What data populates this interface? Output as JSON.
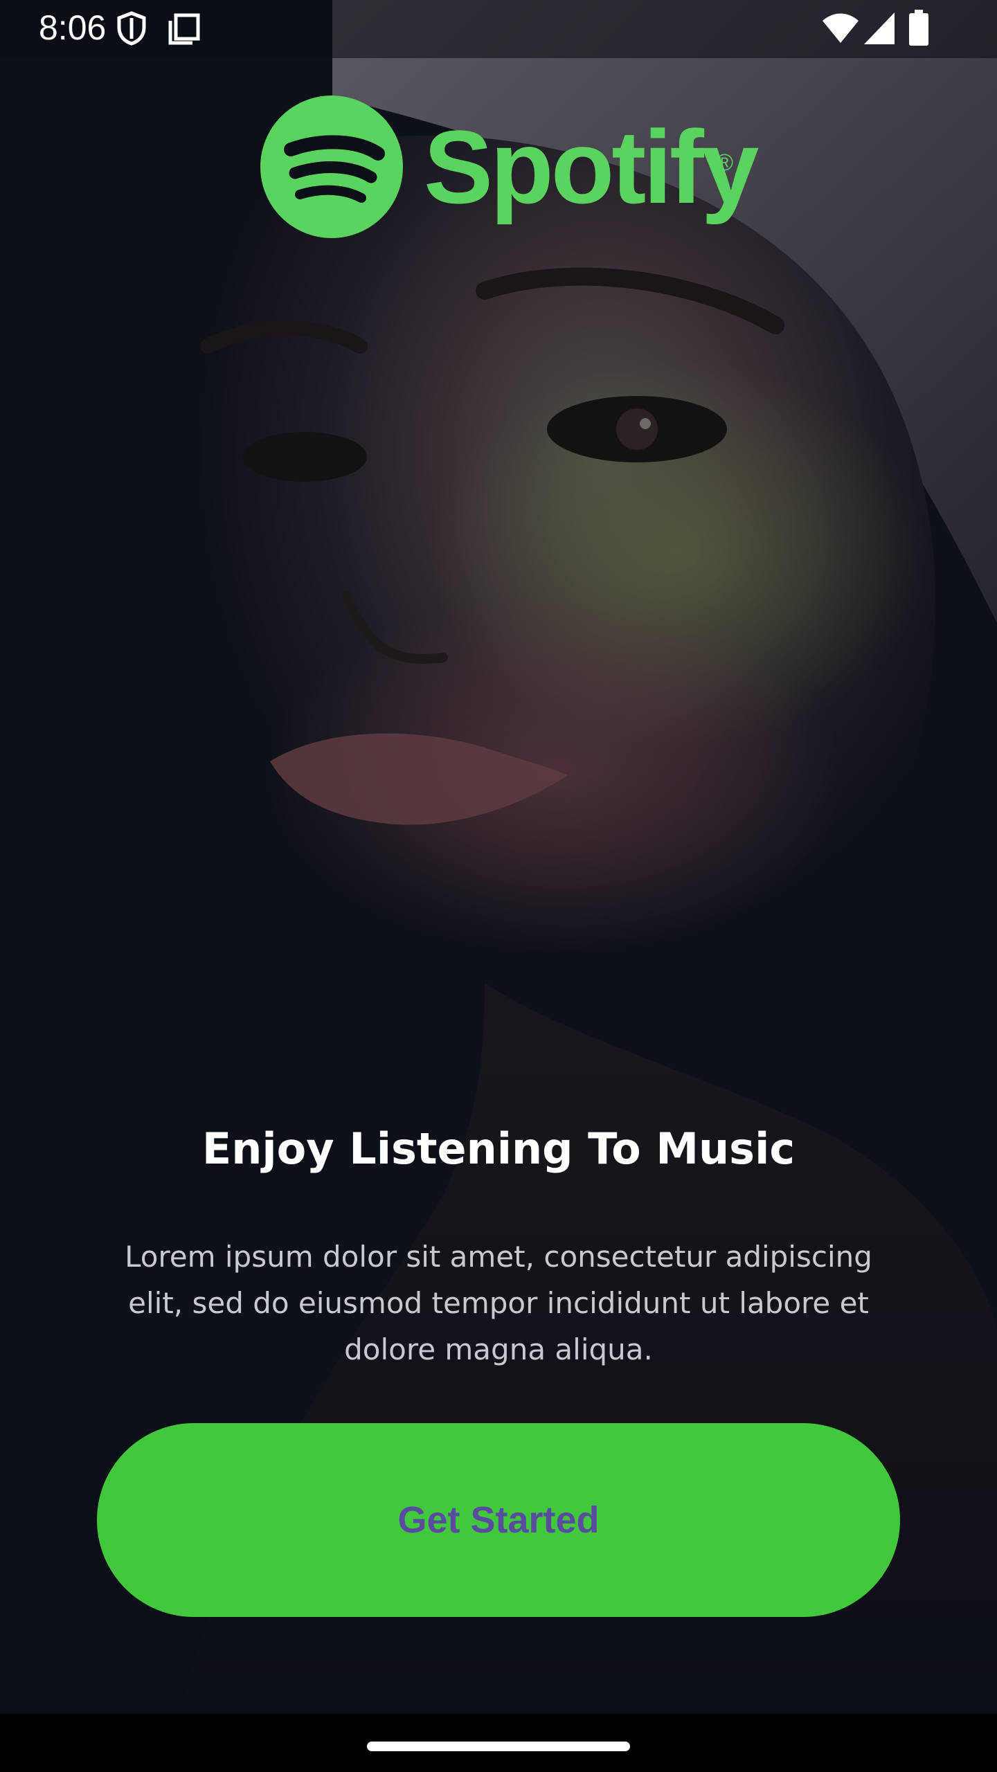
{
  "status_bar": {
    "time": "8:06",
    "icons": [
      "shield-icon",
      "screenshot-icon",
      "wifi-icon",
      "signal-icon",
      "battery-icon"
    ]
  },
  "logo": {
    "wordmark": "Spotify",
    "registered": "®",
    "color": "#5bd35f"
  },
  "onboarding": {
    "title": "Enjoy Listening To Music",
    "description": "Lorem ipsum dolor sit amet, consectetur adipiscing elit, sed do eiusmod tempor incididunt ut labore et dolore magna aliqua.",
    "cta_label": "Get Started"
  },
  "colors": {
    "accent": "#42c83c",
    "cta_text": "#5a4ba1",
    "background": "#0c0f16"
  }
}
